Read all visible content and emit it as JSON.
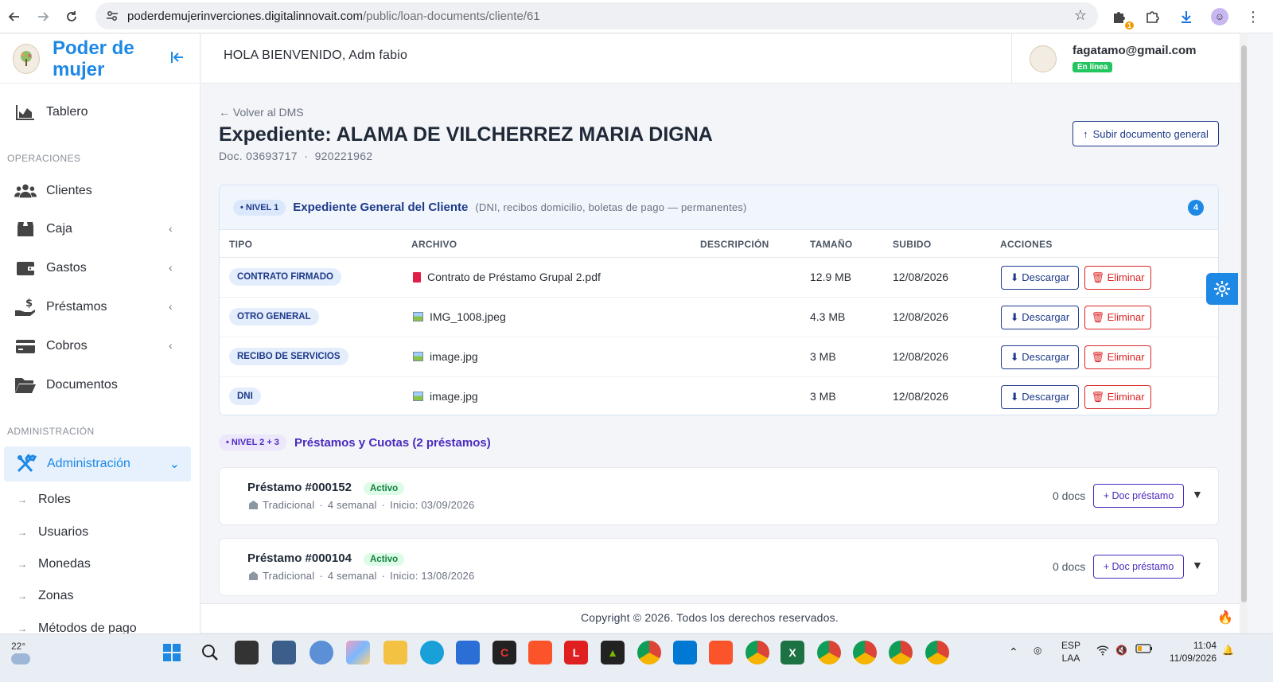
{
  "browser": {
    "url_domain": "poderdemujerinverciones.digitalinnovait.com",
    "url_path": "/public/loan-documents/cliente/61",
    "extension_badge": "1"
  },
  "sidebar": {
    "brand": "Poder de mujer",
    "items": [
      {
        "label": "Tablero",
        "icon": "chart-area-icon"
      },
      {
        "label": "Clientes",
        "icon": "users-icon"
      },
      {
        "label": "Caja",
        "icon": "box-icon"
      },
      {
        "label": "Gastos",
        "icon": "wallet-icon"
      },
      {
        "label": "Préstamos",
        "icon": "hand-dollar-icon"
      },
      {
        "label": "Cobros",
        "icon": "credit-card-icon"
      },
      {
        "label": "Documentos",
        "icon": "folder-open-icon"
      }
    ],
    "section_operaciones": "OPERACIONES",
    "section_admin": "ADMINISTRACIÓN",
    "admin_active": "Administración",
    "admin_sub": [
      "Roles",
      "Usuarios",
      "Monedas",
      "Zonas",
      "Métodos de pago"
    ]
  },
  "header": {
    "greeting": "HOLA BIENVENIDO, Adm fabio",
    "email": "fagatamo@gmail.com",
    "status": "En línea"
  },
  "page": {
    "back_link": "← Volver al DMS",
    "title": "Expediente: ALAMA DE VILCHERREZ MARIA DIGNA",
    "subtitle": "Doc. 03693717  ·  920221962",
    "upload_button": "Subir documento general"
  },
  "level1": {
    "pill": "• NIVEL 1",
    "title": "Expediente General del Cliente",
    "description": "(DNI, recibos domicilio, boletas de pago — permanentes)",
    "count": "4",
    "columns": [
      "TIPO",
      "ARCHIVO",
      "DESCRIPCIÓN",
      "TAMAÑO",
      "SUBIDO",
      "ACCIONES"
    ],
    "download_label": "⬇ Descargar",
    "delete_label": "🗑 Eliminar",
    "rows": [
      {
        "type": "CONTRATO FIRMADO",
        "file": "Contrato de Préstamo Grupal 2.pdf",
        "kind": "pdf",
        "size": "12.9 MB",
        "date": "12/08/2026"
      },
      {
        "type": "OTRO GENERAL",
        "file": "IMG_1008.jpeg",
        "kind": "image",
        "size": "4.3 MB",
        "date": "12/08/2026"
      },
      {
        "type": "RECIBO DE SERVICIOS",
        "file": "image.jpg",
        "kind": "image",
        "size": "3 MB",
        "date": "12/08/2026"
      },
      {
        "type": "DNI",
        "file": "image.jpg",
        "kind": "image",
        "size": "3 MB",
        "date": "12/08/2026"
      }
    ]
  },
  "level2": {
    "pill": "• NIVEL 2 + 3",
    "title": "Préstamos y Cuotas (2 préstamos)",
    "add_label": "+ Doc préstamo",
    "loans": [
      {
        "name": "Préstamo #000152",
        "status": "Activo",
        "kind": "Tradicional",
        "term": "4 semanal",
        "start": "Inicio: 03/09/2026",
        "docs": "0 docs"
      },
      {
        "name": "Préstamo #000104",
        "status": "Activo",
        "kind": "Tradicional",
        "term": "4 semanal",
        "start": "Inicio: 13/08/2026",
        "docs": "0 docs"
      }
    ]
  },
  "footer": {
    "copyright": "Copyright © 2026. Todos los derechos reservados."
  },
  "taskbar": {
    "temp": "22°",
    "lang_top": "ESP",
    "lang_bottom": "LAA",
    "time": "11:04",
    "date": "11/09/2026"
  },
  "colors": {
    "primary": "#1e88e5",
    "navy": "#1e3a8a",
    "danger": "#dc2626",
    "purple": "#4c2bbf",
    "success": "#22c55e"
  }
}
